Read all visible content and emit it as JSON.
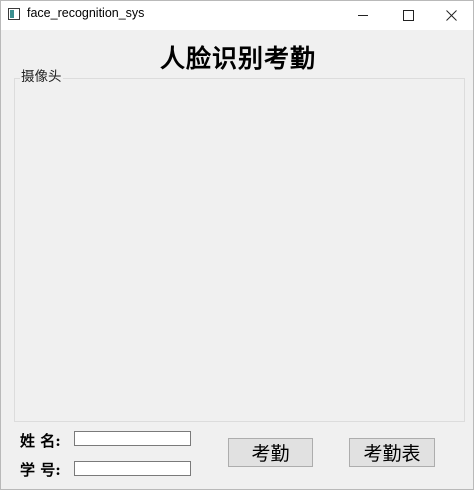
{
  "window": {
    "title": "face_recognition_sys"
  },
  "main": {
    "title": "人脸识别考勤",
    "camera_group_label": "摄像头"
  },
  "form": {
    "name_label": "姓  名:",
    "name_value": "",
    "id_label": "学  号:",
    "id_value": ""
  },
  "buttons": {
    "attendance_label": "考勤",
    "attendance_table_label": "考勤表"
  },
  "icons": {
    "app": "window-app-icon",
    "minimize": "minimize-icon",
    "maximize": "maximize-icon",
    "close": "close-icon"
  }
}
